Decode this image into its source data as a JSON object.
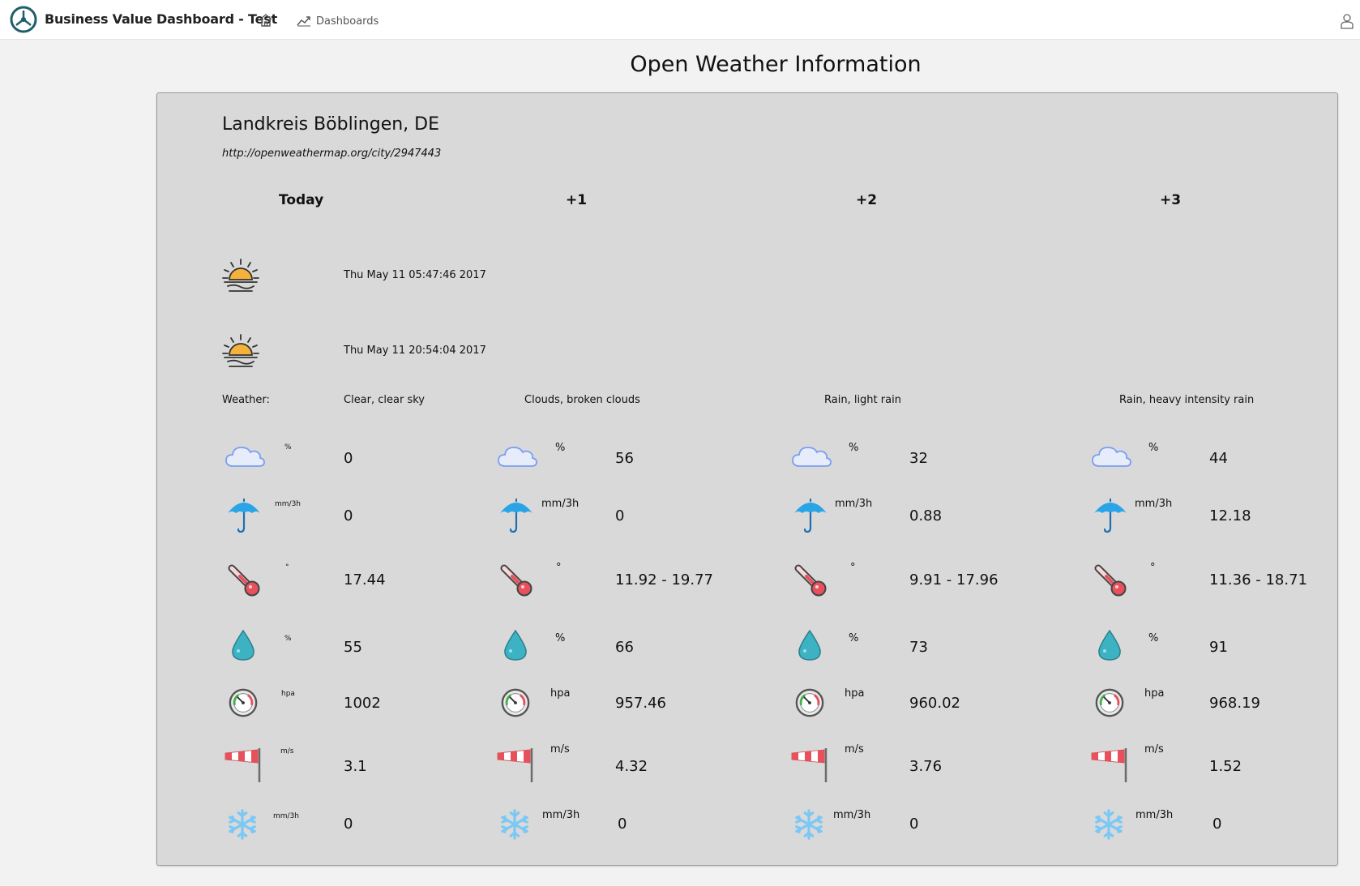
{
  "header": {
    "app_title": "Business Value Dashboard - Test",
    "nav_dashboards": "Dashboards",
    "icons": [
      "app-logo-icon",
      "home-icon",
      "chart-line-icon",
      "user-icon"
    ]
  },
  "page": {
    "title": "Open Weather Information"
  },
  "location": {
    "name": "Landkreis Böblingen, DE",
    "url": "http://openweathermap.org/city/2947443"
  },
  "sun": {
    "sunrise": "Thu May 11 05:47:46 2017",
    "sunset": "Thu May 11 20:54:04 2017"
  },
  "weather_label": "Weather:",
  "units": {
    "clouds": "%",
    "rain": "mm/3h",
    "temp": "°",
    "humidity": "%",
    "pressure": "hpa",
    "wind": "m/s",
    "snow": "mm/3h"
  },
  "days": [
    {
      "label": "Today",
      "weather": "Clear, clear sky",
      "clouds": "0",
      "rain": "0",
      "temp": "17.44",
      "humidity": "55",
      "pressure": "1002",
      "wind": "3.1",
      "snow": "0"
    },
    {
      "label": "+1",
      "weather": "Clouds, broken clouds",
      "clouds": "56",
      "rain": "0",
      "temp": "11.92 - 19.77",
      "humidity": "66",
      "pressure": "957.46",
      "wind": "4.32",
      "snow": "0"
    },
    {
      "label": "+2",
      "weather": "Rain, light rain",
      "clouds": "32",
      "rain": "0.88",
      "temp": "9.91 - 17.96",
      "humidity": "73",
      "pressure": "960.02",
      "wind": "3.76",
      "snow": "0"
    },
    {
      "label": "+3",
      "weather": "Rain, heavy intensity rain",
      "clouds": "44",
      "rain": "12.18",
      "temp": "11.36 - 18.71",
      "humidity": "91",
      "pressure": "968.19",
      "wind": "1.52",
      "snow": "0"
    }
  ],
  "colors": {
    "panel_bg": "#d9d9d9",
    "page_bg": "#f2f2f2",
    "sun": "#f4b23a",
    "umbrella": "#29a4e6",
    "thermometer": "#e8505b",
    "drop": "#3cb2c2",
    "snow": "#7cc8f4",
    "cloud": "#7a9ef0"
  }
}
